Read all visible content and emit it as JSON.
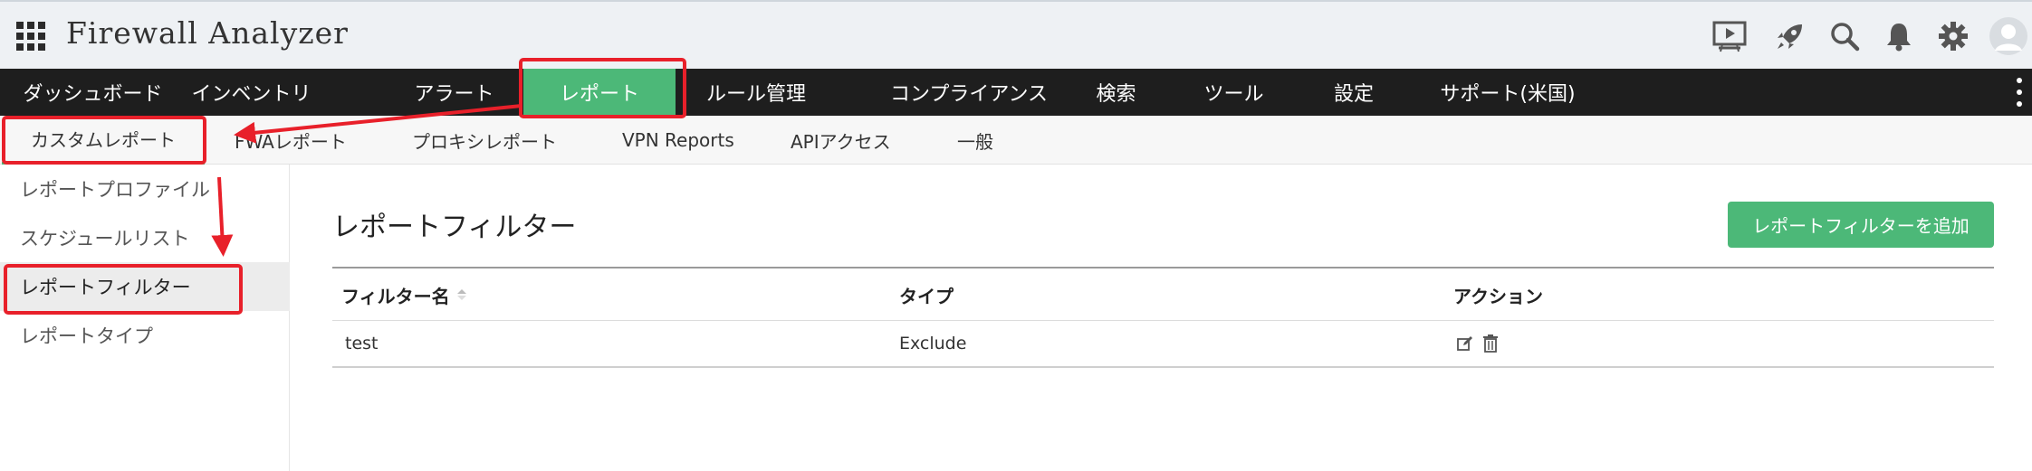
{
  "app": {
    "title": "Firewall Analyzer"
  },
  "header_icons": [
    "presentation-icon",
    "rocket-icon",
    "search-icon",
    "bell-icon",
    "gear-icon",
    "user-avatar-icon"
  ],
  "main_nav": {
    "items": [
      {
        "label": "ダッシュボード"
      },
      {
        "label": "インベントリ"
      },
      {
        "label": "アラート"
      },
      {
        "label": "レポート",
        "active": true
      },
      {
        "label": "ルール管理"
      },
      {
        "label": "コンプライアンス"
      },
      {
        "label": "検索"
      },
      {
        "label": "ツール"
      },
      {
        "label": "設定"
      },
      {
        "label": "サポート(米国)"
      }
    ]
  },
  "sub_nav": {
    "items": [
      {
        "label": "カスタムレポート",
        "active": true
      },
      {
        "label": "FWAレポート"
      },
      {
        "label": "プロキシレポート"
      },
      {
        "label": "VPN Reports"
      },
      {
        "label": "APIアクセス"
      },
      {
        "label": "一般"
      }
    ]
  },
  "sidebar": {
    "items": [
      {
        "label": "レポートプロファイル"
      },
      {
        "label": "スケジュールリスト"
      },
      {
        "label": "レポートフィルター",
        "active": true
      },
      {
        "label": "レポートタイプ"
      }
    ]
  },
  "main": {
    "title": "レポートフィルター",
    "add_button": "レポートフィルターを追加",
    "table": {
      "headers": [
        "フィルター名",
        "タイプ",
        "アクション"
      ],
      "rows": [
        {
          "name": "test",
          "type": "Exclude",
          "actions": [
            "edit-icon",
            "trash-icon"
          ]
        }
      ]
    }
  },
  "colors": {
    "accent": "#4cb878",
    "annotation": "#e8202a",
    "nav_bg": "#1e1e1e"
  }
}
